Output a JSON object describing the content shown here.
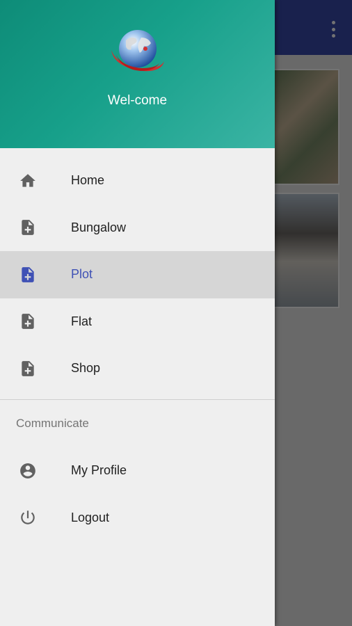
{
  "drawer": {
    "welcome_text": "Wel-come",
    "main_items": [
      {
        "label": "Home",
        "icon": "home-icon",
        "active": false
      },
      {
        "label": "Bungalow",
        "icon": "add-document-icon",
        "active": false
      },
      {
        "label": "Plot",
        "icon": "add-document-icon",
        "active": true
      },
      {
        "label": "Flat",
        "icon": "add-document-icon",
        "active": false
      },
      {
        "label": "Shop",
        "icon": "add-document-icon",
        "active": false
      }
    ],
    "section_title": "Communicate",
    "communicate_items": [
      {
        "label": "My Profile",
        "icon": "account-circle-icon"
      },
      {
        "label": "Logout",
        "icon": "power-icon"
      }
    ]
  },
  "colors": {
    "header_gradient_start": "#0e8c78",
    "header_gradient_end": "#3bb4a4",
    "appbar": "#3949ab",
    "active_accent": "#3f51b5",
    "active_row_bg": "#d6d6d6"
  }
}
